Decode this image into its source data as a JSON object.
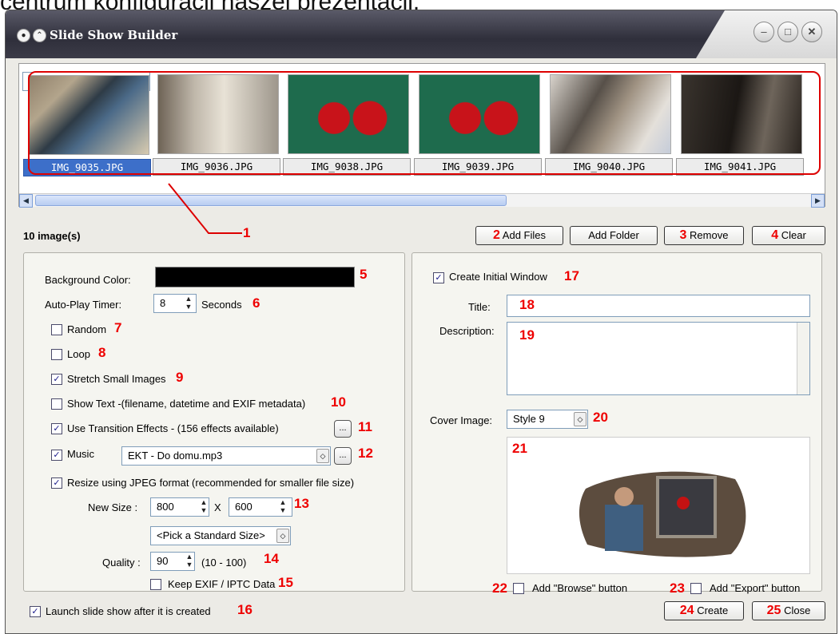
{
  "caption_top": "centrum konfiguracji naszej prezentacji.",
  "window": {
    "title": "Slide Show Builder",
    "controls": [
      "minimize",
      "maximize",
      "close"
    ]
  },
  "thumbnails": [
    {
      "name": "IMG_9035.JPG",
      "selected": true
    },
    {
      "name": "IMG_9036.JPG",
      "selected": false
    },
    {
      "name": "IMG_9038.JPG",
      "selected": false
    },
    {
      "name": "IMG_9039.JPG",
      "selected": false
    },
    {
      "name": "IMG_9040.JPG",
      "selected": false
    },
    {
      "name": "IMG_9041.JPG",
      "selected": false
    }
  ],
  "image_count": "10 image(s)",
  "buttons": {
    "add_files": "Add Files",
    "add_folder": "Add Folder",
    "remove": "Remove",
    "clear": "Clear",
    "create": "Create",
    "close": "Close",
    "ellipsis": "..."
  },
  "left": {
    "background_color_label": "Background Color:",
    "background_color": "#000000",
    "autoplay_label": "Auto-Play Timer:",
    "autoplay_value": "8",
    "seconds_label": "Seconds",
    "random_label": "Random",
    "random_checked": false,
    "loop_label": "Loop",
    "loop_checked": false,
    "stretch_label": "Stretch Small Images",
    "stretch_checked": true,
    "show_text_label": "Show Text -(filename, datetime and EXIF metadata)",
    "show_text_checked": false,
    "transition_label": "Use Transition Effects   -   (156 effects available)",
    "transition_checked": true,
    "music_label": "Music",
    "music_checked": true,
    "music_value": "EKT  - Do domu.mp3",
    "resize_label": "Resize using JPEG format (recommended for smaller file size)",
    "resize_checked": true,
    "new_size_label": "New Size :",
    "width_value": "800",
    "x_label": "X",
    "height_value": "600",
    "standard_size": "<Pick a Standard Size>",
    "quality_label": "Quality :",
    "quality_value": "90",
    "quality_range": "(10 - 100)",
    "keep_exif_label": "Keep EXIF / IPTC Data",
    "keep_exif_checked": false
  },
  "right": {
    "create_initial_label": "Create Initial Window",
    "create_initial_checked": true,
    "title_label": "Title:",
    "title_value": "",
    "description_label": "Description:",
    "description_value": "",
    "cover_label": "Cover Image:",
    "cover_value": "Style 9",
    "browse_label": "Add \"Browse\" button",
    "browse_checked": false,
    "export_label": "Add \"Export\" button",
    "export_checked": false
  },
  "launch_label": "Launch slide show after it is created",
  "launch_checked": true,
  "callouts": [
    "1",
    "2",
    "3",
    "4",
    "5",
    "6",
    "7",
    "8",
    "9",
    "10",
    "11",
    "12",
    "13",
    "14",
    "15",
    "16",
    "17",
    "18",
    "19",
    "20",
    "21",
    "22",
    "23",
    "24",
    "25"
  ],
  "colors": {
    "accent_red": "#dd0000",
    "selection_blue": "#3d6fc9",
    "window_bg": "#ecebe6"
  }
}
